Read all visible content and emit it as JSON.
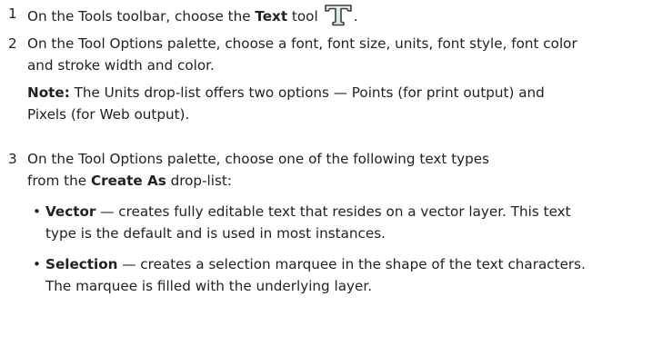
{
  "steps": [
    {
      "number": "1",
      "before": "On the Tools toolbar, choose the ",
      "bold": "Text",
      "after": " tool",
      "end": ".",
      "icon": "text-tool-icon"
    },
    {
      "number": "2",
      "text": "On the Tool Options palette, choose a font, font size, units, font style, font color and stroke width and color.",
      "note_label": "Note:",
      "note_text": "The Units drop-list offers two options — Points (for print output) and Pixels (for Web output)."
    },
    {
      "number": "3",
      "before": "On the Tool Options palette, choose one of the following text types from the ",
      "bold": "Create As",
      "after": " drop-list:",
      "bullets": [
        {
          "symbol": "•",
          "term": "Vector",
          "text": " — creates fully editable text that resides on a vector layer. This text type is the default and is used in most instances."
        },
        {
          "symbol": "•",
          "term": "Selection",
          "text": " — creates a selection marquee in the shape of the text characters. The marquee is filled with the underlying layer."
        }
      ]
    }
  ],
  "colors": {
    "text": "#222222",
    "icon_fill": "#dce9e9",
    "icon_stroke": "#3e3e3e"
  }
}
